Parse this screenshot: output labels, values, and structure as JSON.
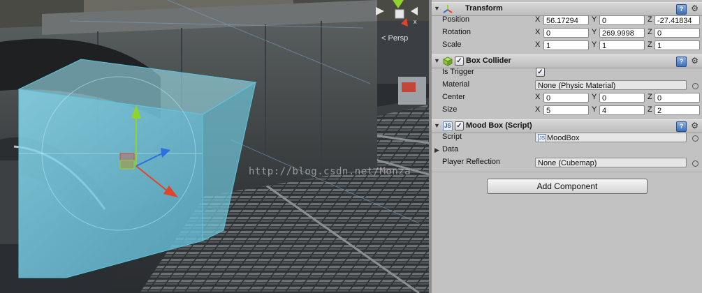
{
  "scene": {
    "view_mode_label": "Persp",
    "watermark_text": "http://blog.csdn.net/Monza",
    "icons": [
      "scene-gizmo-icon",
      "move-gizmo-icon"
    ]
  },
  "inspector": {
    "transform": {
      "title": "Transform",
      "position": {
        "label": "Position",
        "x": "56.17294",
        "y": "0",
        "z": "-27.41834"
      },
      "rotation": {
        "label": "Rotation",
        "x": "0",
        "y": "269.9998",
        "z": "0"
      },
      "scale": {
        "label": "Scale",
        "x": "1",
        "y": "1",
        "z": "1"
      }
    },
    "box_collider": {
      "title": "Box Collider",
      "enabled": true,
      "is_trigger_label": "Is Trigger",
      "is_trigger": true,
      "material_label": "Material",
      "material_value": "None (Physic Material)",
      "center": {
        "label": "Center",
        "x": "0",
        "y": "0",
        "z": "0"
      },
      "size": {
        "label": "Size",
        "x": "5",
        "y": "4",
        "z": "2"
      }
    },
    "mood_box": {
      "title": "Mood Box (Script)",
      "enabled": true,
      "script_label": "Script",
      "script_value": "MoodBox",
      "data_label": "Data",
      "player_reflection_label": "Player Reflection",
      "player_reflection_value": "None (Cubemap)"
    },
    "axis_labels": {
      "x": "X",
      "y": "Y",
      "z": "Z"
    },
    "add_component_label": "Add Component"
  },
  "colors": {
    "collider_fill": "#7fd3e8",
    "gizmo_x": "#e0452b",
    "gizmo_y": "#8fd32b",
    "gizmo_z": "#2b6fe0",
    "header_bg": "#c9c9c9"
  }
}
